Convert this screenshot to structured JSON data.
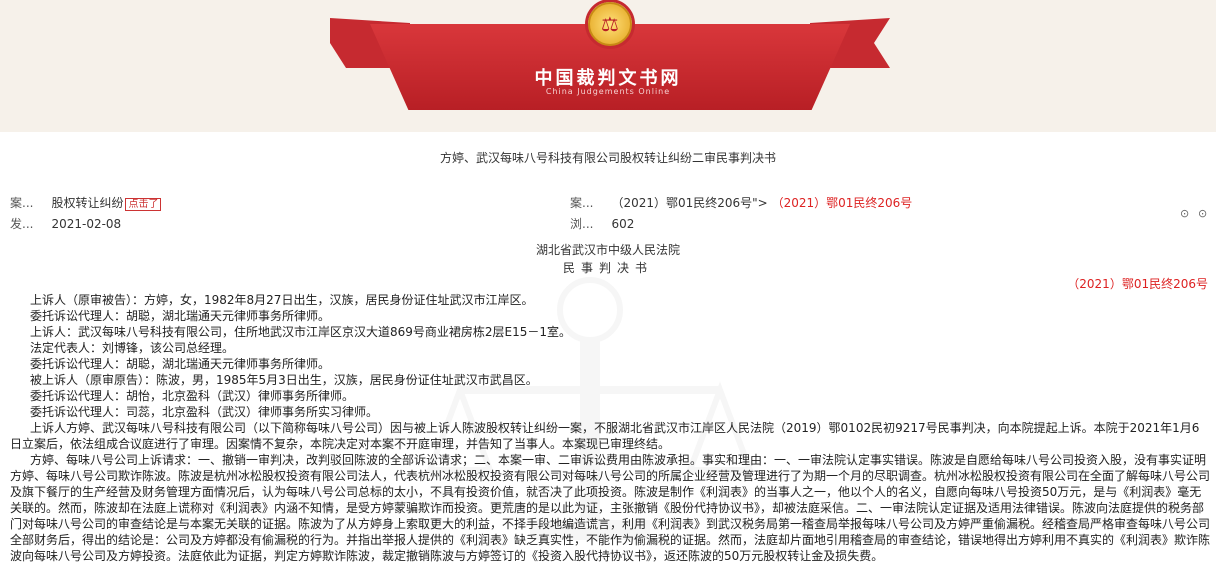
{
  "site": {
    "name_cn": "中国裁判文书网",
    "name_en": "China Judgements Online"
  },
  "document": {
    "title": "方婷、武汉每味八号科技有限公司股权转让纠纷二审民事判决书",
    "meta": {
      "cause_label": "案...",
      "cause_value": "股权转让纠纷",
      "cause_badge": "点击了",
      "date_label": "发...",
      "date_value": "2021-02-08",
      "caseno_label": "案...",
      "caseno_value": "（2021）鄂01民终206号\"> ",
      "caseno_red": "（2021）鄂01民终206号",
      "views_label": "浏...",
      "views_value": "602"
    },
    "tools": [
      "⊙",
      "⊙"
    ],
    "court": "湖北省武汉市中级人民法院",
    "doc_type": "民事判决书",
    "case_number": "（2021）鄂01民终206号",
    "paragraphs": [
      "上诉人（原审被告）：方婷，女，1982年8月27日出生，汉族，居民身份证住址武汉市江岸区。",
      "委托诉讼代理人：胡聪，湖北瑞通天元律师事务所律师。",
      "上诉人：武汉每味八号科技有限公司，住所地武汉市江岸区京汉大道869号商业裙房栋2层E15－1室。",
      "法定代表人：刘博锋，该公司总经理。",
      "委托诉讼代理人：胡聪，湖北瑞通天元律师事务所律师。",
      "被上诉人（原审原告）：陈波，男，1985年5月3日出生，汉族，居民身份证住址武汉市武昌区。",
      "委托诉讼代理人：胡怡，北京盈科（武汉）律师事务所律师。",
      "委托诉讼代理人：司蕊，北京盈科（武汉）律师事务所实习律师。"
    ],
    "long_paragraphs": [
      "上诉人方婷、武汉每味八号科技有限公司（以下简称每味八号公司）因与被上诉人陈波股权转让纠纷一案，不服湖北省武汉市江岸区人民法院（2019）鄂0102民初9217号民事判决，向本院提起上诉。本院于2021年1月6日立案后，依法组成合议庭进行了审理。因案情不复杂，本院决定对本案不开庭审理，并告知了当事人。本案现已审理终结。",
      "方婷、每味八号公司上诉请求：一、撤销一审判决，改判驳回陈波的全部诉讼请求；二、本案一审、二审诉讼费用由陈波承担。事实和理由：一、一审法院认定事实错误。陈波是自愿给每味八号公司投资入股，没有事实证明方婷、每味八号公司欺诈陈波。陈波是杭州冰松股权投资有限公司法人，代表杭州冰松股权投资有限公司对每味八号公司的所属企业经营及管理进行了为期一个月的尽职调查。杭州冰松股权投资有限公司在全面了解每味八号公司及旗下餐厅的生产经营及财务管理方面情况后，认为每味八号公司总标的太小，不具有投资价值，就否决了此项投资。陈波是制作《利润表》的当事人之一，他以个人的名义，自愿向每味八号投资50万元，是与《利润表》毫无关联的。然而，陈波却在法庭上谎称对《利润表》内涵不知情，是受方婷蒙骗欺诈而投资。更荒唐的是以此为证，主张撤销《股份代持协议书》，却被法庭采信。二、一审法院认定证据及适用法律错误。陈波向法庭提供的税务部门对每味八号公司的审查结论是与本案无关联的证据。陈波为了从方婷身上索取更大的利益，不择手段地编造谎言，利用《利润表》到武汉税务局第一稽查局举报每味八号公司及方婷严重偷漏税。经稽查局严格审查每味八号公司全部财务后，得出的结论是：公司及方婷都没有偷漏税的行为。并指出举报人提供的《利润表》缺乏真实性，不能作为偷漏税的证据。然而，法庭却片面地引用稽查局的审查结论，错误地得出方婷利用不真实的《利润表》欺诈陈波向每味八号公司及方婷投资。法庭依此为证据，判定方婷欺诈陈波，裁定撤销陈波与方婷签订的《投资入股代持协议书》，返还陈波的50万元股权转让金及损失费。"
    ]
  }
}
